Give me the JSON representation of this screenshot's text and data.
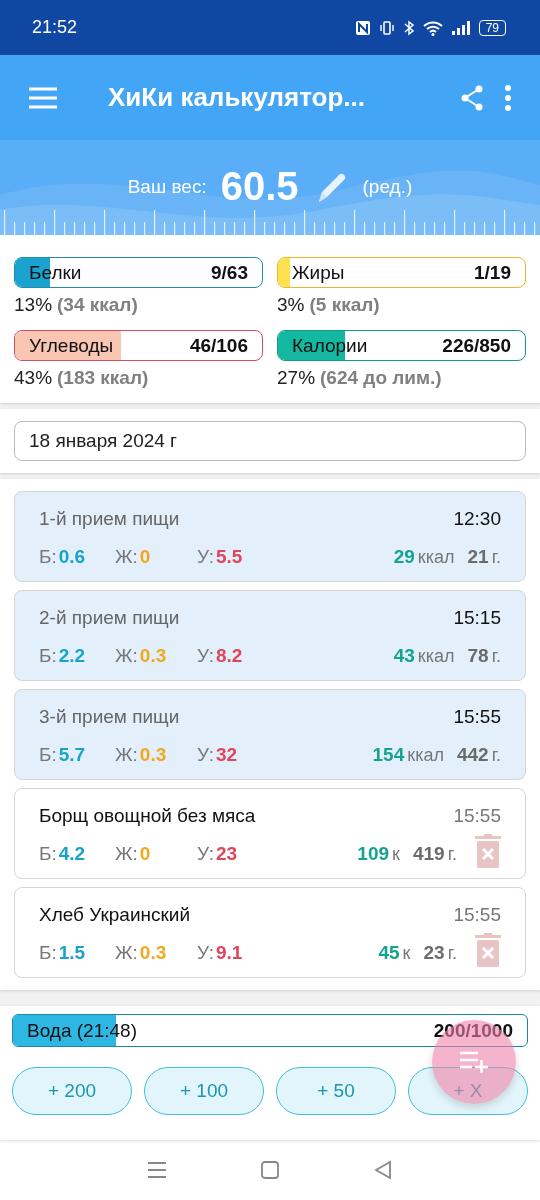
{
  "status_bar": {
    "time": "21:52",
    "battery": "79"
  },
  "app_bar": {
    "title": "ХиКи калькулятор..."
  },
  "weight": {
    "label": "Ваш вес:",
    "value": "60.5",
    "edit": "(ред.)"
  },
  "macros": [
    {
      "kind": "protein",
      "label": "Белки",
      "value": "9/63",
      "level": 0.14,
      "percent": "13%",
      "detail": "(34 ккал)"
    },
    {
      "kind": "fat",
      "label": "Жиры",
      "value": "1/19",
      "level": 0.05,
      "percent": "3%",
      "detail": "(5 ккал)"
    },
    {
      "kind": "carbs",
      "label": "Углеводы",
      "value": "46/106",
      "level": 0.43,
      "percent": "43%",
      "detail": "(183 ккал)"
    },
    {
      "kind": "calories",
      "label": "Калории",
      "value": "226/850",
      "level": 0.27,
      "percent": "27%",
      "detail": "(624 до лим.)"
    }
  ],
  "date": {
    "value": "18 января 2024 г"
  },
  "entries": [
    {
      "kind": "meal",
      "title": "1-й прием пищи",
      "time": "12:30",
      "nutrients": [
        {
          "kind": "protein",
          "label": "Б:",
          "value": "0.6"
        },
        {
          "kind": "fat",
          "label": "Ж:",
          "value": "0"
        },
        {
          "kind": "carbs",
          "label": "У:",
          "value": "5.5"
        }
      ],
      "kcal": "29",
      "kcal_unit": "ккал",
      "grams": "21",
      "grams_unit": "г."
    },
    {
      "kind": "meal",
      "title": "2-й прием пищи",
      "time": "15:15",
      "nutrients": [
        {
          "kind": "protein",
          "label": "Б:",
          "value": "2.2"
        },
        {
          "kind": "fat",
          "label": "Ж:",
          "value": "0.3"
        },
        {
          "kind": "carbs",
          "label": "У:",
          "value": "8.2"
        }
      ],
      "kcal": "43",
      "kcal_unit": "ккал",
      "grams": "78",
      "grams_unit": "г."
    },
    {
      "kind": "meal",
      "title": "3-й прием пищи",
      "time": "15:55",
      "nutrients": [
        {
          "kind": "protein",
          "label": "Б:",
          "value": "5.7"
        },
        {
          "kind": "fat",
          "label": "Ж:",
          "value": "0.3"
        },
        {
          "kind": "carbs",
          "label": "У:",
          "value": "32"
        }
      ],
      "kcal": "154",
      "kcal_unit": "ккал",
      "grams": "442",
      "grams_unit": "г."
    },
    {
      "kind": "food",
      "title": "Борщ овощной без мяса",
      "time": "15:55",
      "nutrients": [
        {
          "kind": "protein",
          "label": "Б:",
          "value": "4.2"
        },
        {
          "kind": "fat",
          "label": "Ж:",
          "value": "0"
        },
        {
          "kind": "carbs",
          "label": "У:",
          "value": "23"
        }
      ],
      "kcal": "109",
      "kcal_unit": "к",
      "grams": "419",
      "grams_unit": "г."
    },
    {
      "kind": "food",
      "title": "Хлеб Украинский",
      "time": "15:55",
      "nutrients": [
        {
          "kind": "protein",
          "label": "Б:",
          "value": "1.5"
        },
        {
          "kind": "fat",
          "label": "Ж:",
          "value": "0.3"
        },
        {
          "kind": "carbs",
          "label": "У:",
          "value": "9.1"
        }
      ],
      "kcal": "45",
      "kcal_unit": "к",
      "grams": "23",
      "grams_unit": "г."
    }
  ],
  "water": {
    "label": "Вода (21:48)",
    "value": "200/1000",
    "level": 0.2
  },
  "water_buttons": [
    "+ 200",
    "+ 100",
    "+ 50",
    "+ X"
  ]
}
